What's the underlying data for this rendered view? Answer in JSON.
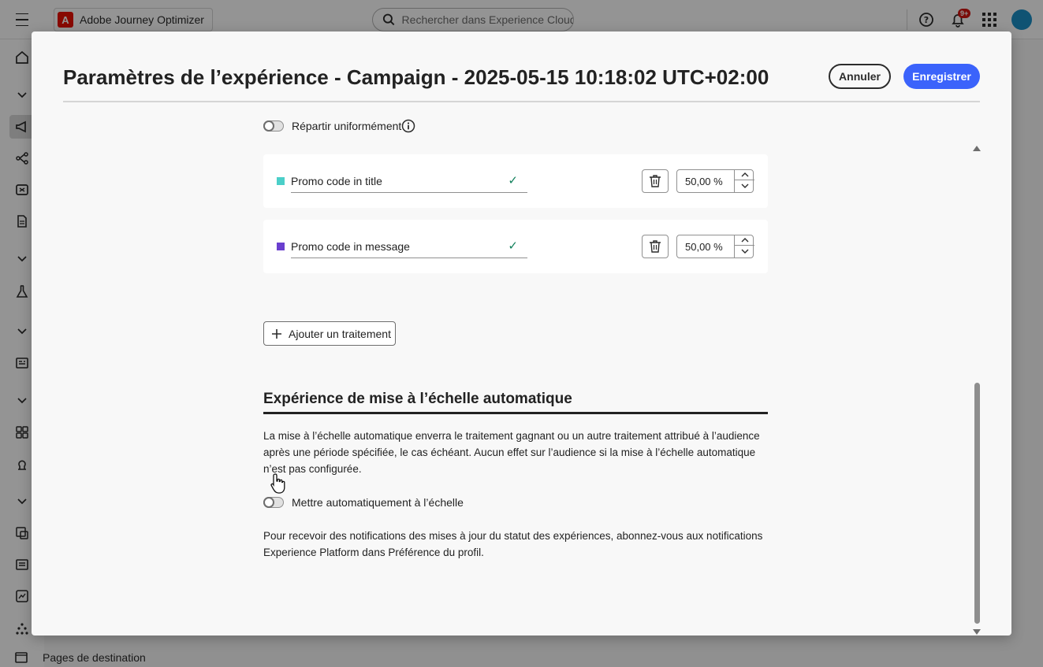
{
  "app": {
    "brand_name": "Adobe Journey Optimizer",
    "brand_logo_letter": "A",
    "search_placeholder": "Rechercher dans Experience Cloud ...",
    "notification_count": "9+",
    "bottom_nav_label": "Pages de destination"
  },
  "modal": {
    "title": "Paramètres de l’expérience  - Campaign - 2025-05-15 10:18:02 UTC+02:00",
    "cancel_label": "Annuler",
    "save_label": "Enregistrer"
  },
  "distribution": {
    "even_split_label": "Répartir uniformément",
    "even_split_on": false,
    "treatments": [
      {
        "name": "Promo code in title",
        "color": "#4bcfc9",
        "percent": "50,00 %"
      },
      {
        "name": "Promo code in message",
        "color": "#6a3fcf",
        "percent": "50,00 %"
      }
    ],
    "add_treatment_label": "Ajouter un traitement"
  },
  "auto_scale": {
    "heading": "Expérience de mise à l’échelle automatique",
    "description": "La mise à l’échelle automatique enverra le traitement gagnant ou un autre traitement attribué à l’audience après une période spécifiée, le cas échéant. Aucun effet sur l’audience si la mise à l’échelle automatique n’est pas configurée.",
    "toggle_label": "Mettre automatiquement à l’échelle",
    "toggle_on": false,
    "notification_note": "Pour recevoir des notifications des mises à jour du statut des expériences, abonnez-vous aux notifications Experience Platform dans Préférence du profil."
  },
  "colors": {
    "accent": "#3b63fb",
    "check": "#12805c",
    "brand": "#eb1000"
  }
}
